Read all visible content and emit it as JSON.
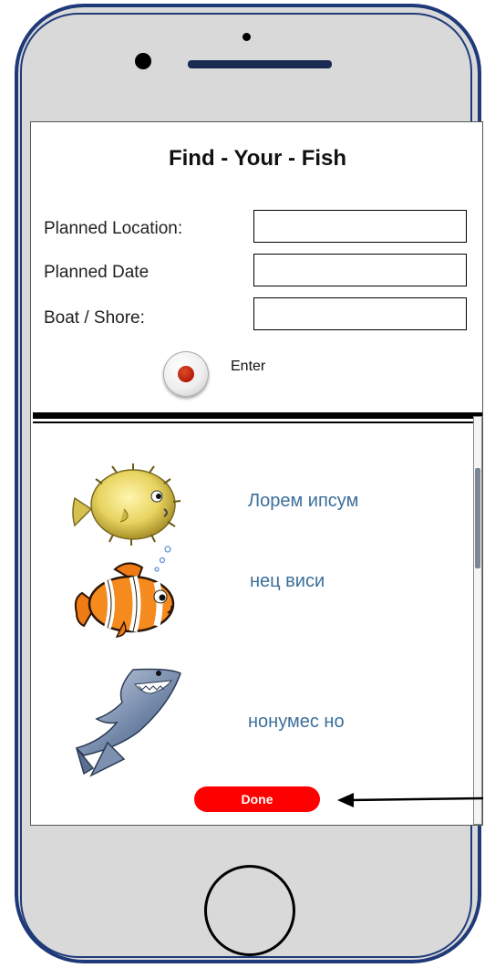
{
  "app": {
    "title": "Find - Your - Fish"
  },
  "form": {
    "location_label": "Planned Location:",
    "location_value": "",
    "date_label": "Planned Date",
    "date_value": "",
    "boat_label": "Boat / Shore:",
    "boat_value": "",
    "enter_label": "Enter"
  },
  "fish_list": [
    {
      "icon": "pufferfish-icon",
      "label": "Лорем ипсум"
    },
    {
      "icon": "clownfish-icon",
      "label": "нец виси"
    },
    {
      "icon": "shark-icon",
      "label": "нонумес но"
    }
  ],
  "done_label": "Done",
  "colors": {
    "phone_border": "#1f3a78",
    "phone_body": "#d9d9d9",
    "fish_text": "#3b6f9b",
    "done_button": "#ff0000"
  }
}
